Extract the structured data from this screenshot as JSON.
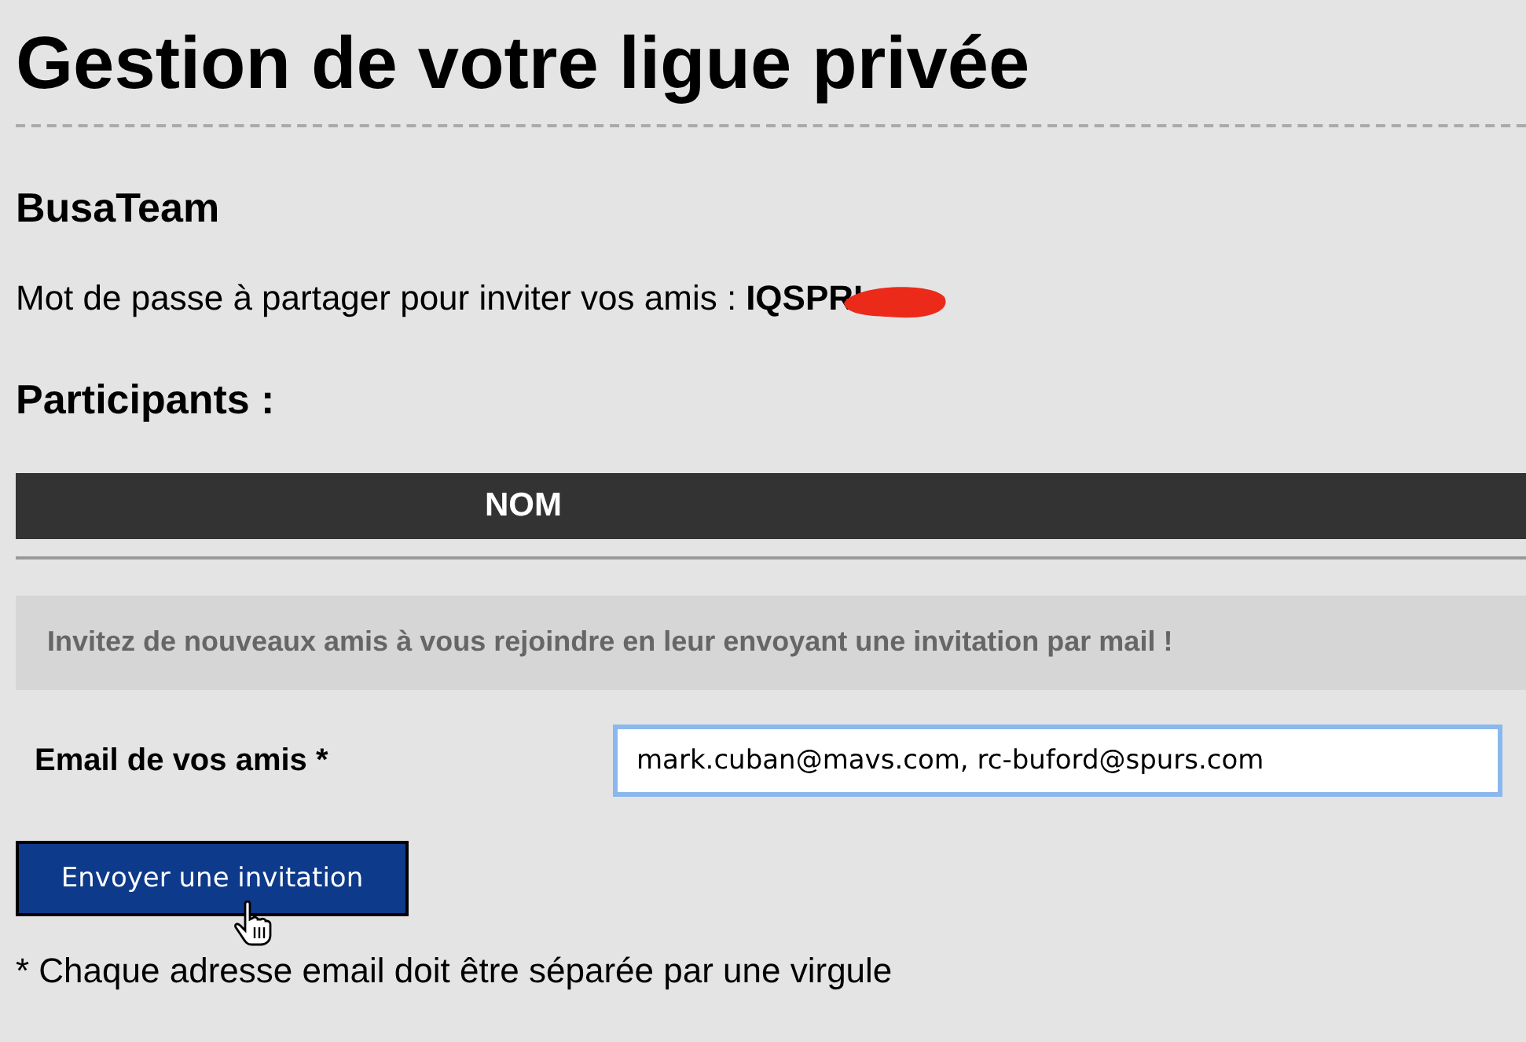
{
  "page": {
    "title": "Gestion de votre ligue privée"
  },
  "league": {
    "name": "BusaTeam",
    "password_label": "Mot de passe à partager pour inviter vos amis :",
    "password": "IQSPRI",
    "redacted": true
  },
  "participants": {
    "heading": "Participants :",
    "columns": [
      "NOM"
    ]
  },
  "invite": {
    "message": "Invitez de nouveaux amis à vous rejoindre en leur envoyant une invitation par mail !",
    "email_label": "Email de vos amis *",
    "email_value": "mark.cuban@mavs.com, rc-buford@spurs.com",
    "focused": true,
    "button": "Envoyer une invitation",
    "note": "* Chaque adresse email doit être séparée par une virgule"
  }
}
